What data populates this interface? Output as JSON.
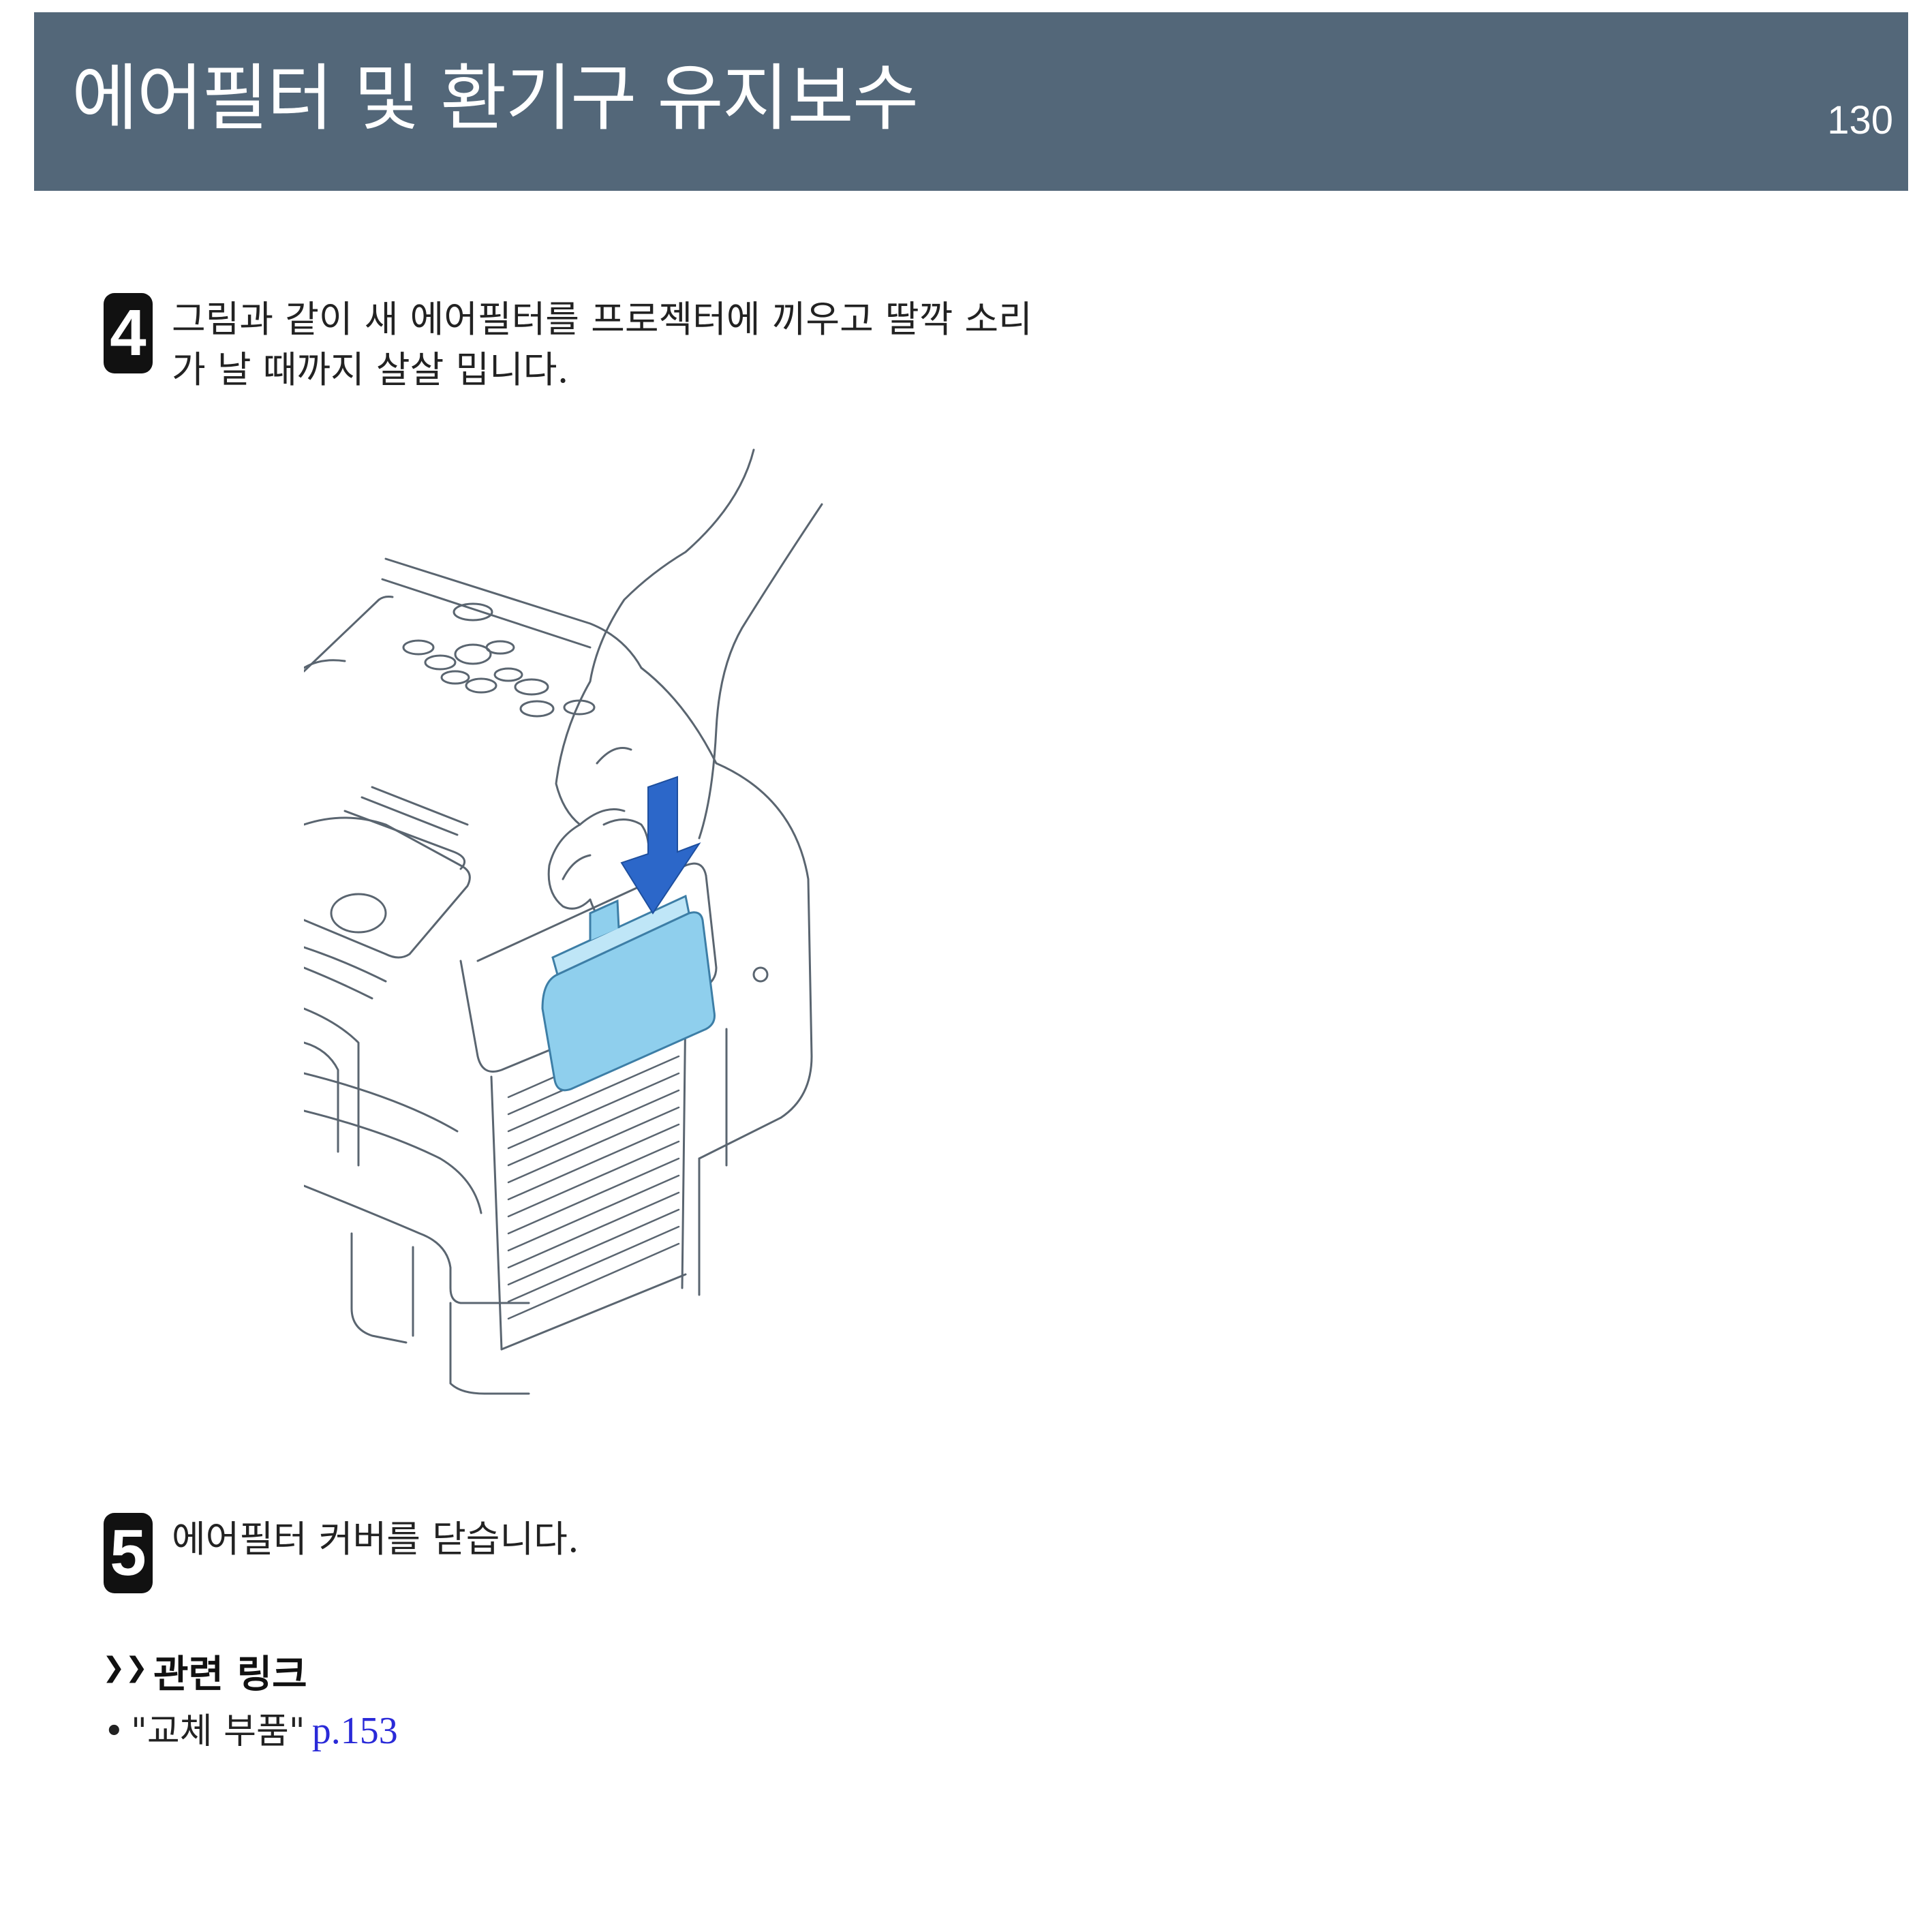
{
  "header": {
    "title": "에어필터 및 환기구 유지보수",
    "page_number": "130"
  },
  "steps": [
    {
      "number": "4",
      "text": "그림과 같이 새 에어필터를 프로젝터에 끼우고 딸깍 소리가 날 때까지 살살 밉니다."
    },
    {
      "number": "5",
      "text": "에어필터 커버를 닫습니다."
    }
  ],
  "related": {
    "arrow": "❯❯",
    "title": "관련 링크",
    "items": [
      {
        "bullet": "•",
        "text": "\"교체 부품\"",
        "link": "p.153"
      }
    ]
  },
  "colors": {
    "header_background": "#536779",
    "filter_fill": "#8fcfed",
    "arrow_fill": "#2c67c9",
    "link": "#2a2ad8"
  },
  "icons": {
    "illustration": "projector-air-filter-install-illustration"
  }
}
